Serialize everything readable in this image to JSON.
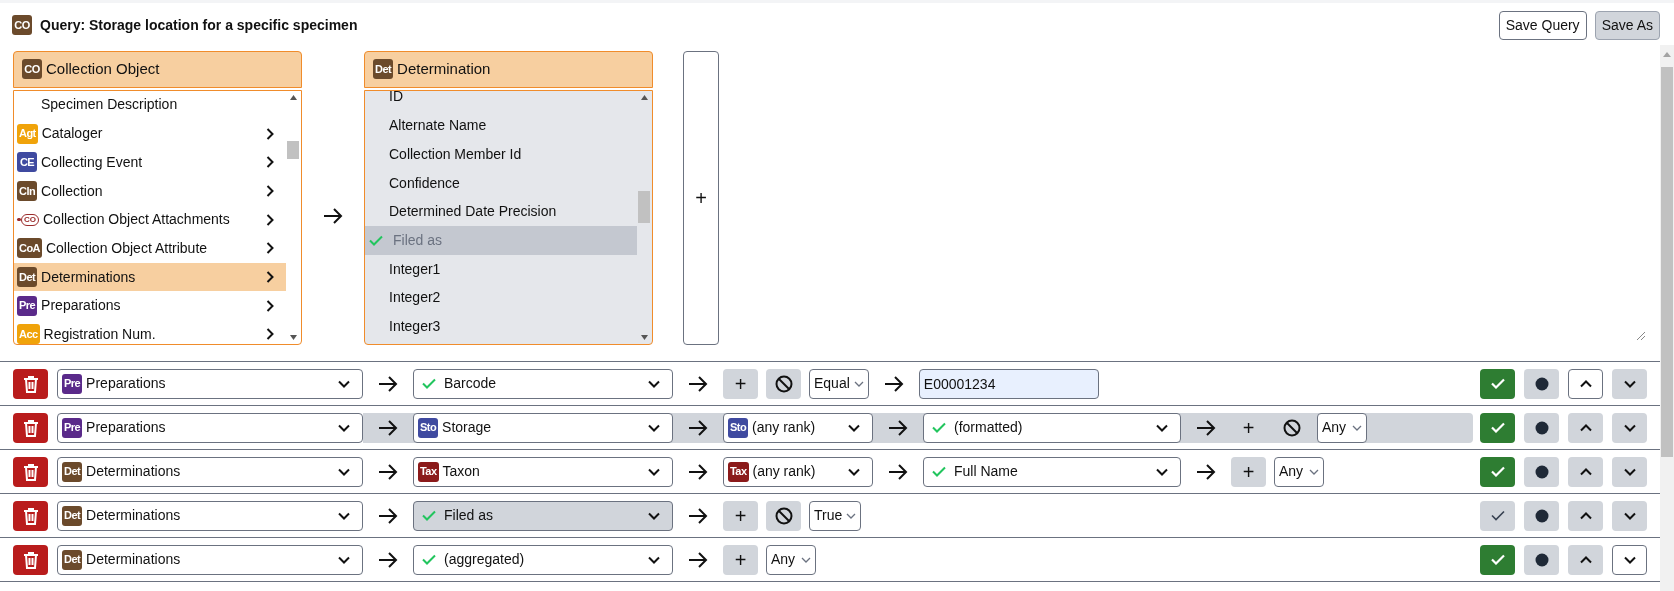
{
  "title": {
    "badge": {
      "text": "CO",
      "color": "#6b4a2b"
    },
    "text": "Query: Storage location for a specific specimen"
  },
  "header_buttons": [
    {
      "label": "Save Query",
      "disabled": false
    },
    {
      "label": "Save As",
      "disabled": true
    }
  ],
  "base_table": {
    "badge": {
      "text": "CO",
      "color": "#6b4a2b"
    },
    "label": "Collection Object",
    "items": [
      {
        "label": "Specimen Description",
        "expandable": false,
        "selected": false
      },
      {
        "label": "Cataloger",
        "badge": {
          "kind": "badge",
          "text": "Agt",
          "color": "#f0a30a"
        },
        "expandable": true,
        "selected": false
      },
      {
        "label": "Collecting Event",
        "badge": {
          "kind": "badge",
          "text": "CE",
          "color": "#3f4aa0"
        },
        "expandable": true,
        "selected": false
      },
      {
        "label": "Collection",
        "badge": {
          "kind": "badge",
          "text": "Cln",
          "color": "#6b4a2b"
        },
        "expandable": true,
        "selected": false
      },
      {
        "label": "Collection Object Attachments",
        "badge": {
          "kind": "attachment",
          "text": "CO",
          "color": "#9b2c2c"
        },
        "expandable": true,
        "selected": false
      },
      {
        "label": "Collection Object Attribute",
        "badge": {
          "kind": "badge",
          "text": "CoA",
          "color": "#6b4a2b"
        },
        "expandable": true,
        "selected": false
      },
      {
        "label": "Determinations",
        "badge": {
          "kind": "badge",
          "text": "Det",
          "color": "#6b4a2b"
        },
        "expandable": true,
        "selected": true
      },
      {
        "label": "Preparations",
        "badge": {
          "kind": "badge",
          "text": "Pre",
          "color": "#5a2a8a"
        },
        "expandable": true,
        "selected": false
      },
      {
        "label": "Registration Num.",
        "badge": {
          "kind": "badge",
          "text": "Acc",
          "color": "#f0a30a"
        },
        "expandable": true,
        "selected": false
      }
    ]
  },
  "related_table": {
    "badge": {
      "text": "Det",
      "color": "#6b4a2b"
    },
    "label": "Determination",
    "items": [
      {
        "label": "ID",
        "selected": false
      },
      {
        "label": "Alternate Name",
        "selected": false
      },
      {
        "label": "Collection Member Id",
        "selected": false
      },
      {
        "label": "Confidence",
        "selected": false
      },
      {
        "label": "Determined Date Precision",
        "selected": false
      },
      {
        "label": "Filed as",
        "selected": true
      },
      {
        "label": "Integer1",
        "selected": false
      },
      {
        "label": "Integer2",
        "selected": false
      },
      {
        "label": "Integer3",
        "selected": false
      }
    ]
  },
  "add_panel": {
    "label": "+"
  },
  "fields": [
    {
      "highlighted": false,
      "display": true,
      "up_disabled": true,
      "down_disabled": false,
      "parts": [
        {
          "kind": "select",
          "label": "Preparations",
          "badge": {
            "text": "Pre",
            "color": "#5a2a8a"
          },
          "checked": false,
          "active": false
        },
        {
          "kind": "select",
          "label": "Barcode",
          "checked": true,
          "active": false
        },
        {
          "kind": "plus",
          "label": "+"
        },
        {
          "kind": "negate"
        },
        {
          "kind": "operator",
          "value": "Equal"
        },
        {
          "kind": "value",
          "value": "E00001234"
        }
      ]
    },
    {
      "highlighted": true,
      "display": true,
      "up_disabled": false,
      "down_disabled": false,
      "parts": [
        {
          "kind": "select",
          "label": "Preparations",
          "badge": {
            "text": "Pre",
            "color": "#5a2a8a"
          },
          "checked": false,
          "active": false
        },
        {
          "kind": "select",
          "label": "Storage",
          "badge": {
            "text": "Sto",
            "color": "#3f4aa0"
          },
          "checked": false,
          "active": false
        },
        {
          "kind": "select",
          "label": "(any rank)",
          "badge": {
            "text": "Sto",
            "color": "#3f4aa0"
          },
          "checked": false,
          "active": false
        },
        {
          "kind": "select",
          "label": "(formatted)",
          "checked": true,
          "active": false
        },
        {
          "kind": "plus",
          "label": "+"
        },
        {
          "kind": "negate"
        },
        {
          "kind": "operator",
          "value": "Any"
        }
      ]
    },
    {
      "highlighted": false,
      "display": true,
      "up_disabled": false,
      "down_disabled": false,
      "parts": [
        {
          "kind": "select",
          "label": "Determinations",
          "badge": {
            "text": "Det",
            "color": "#6b4a2b"
          },
          "checked": false,
          "active": false
        },
        {
          "kind": "select",
          "label": "Taxon",
          "badge": {
            "text": "Tax",
            "color": "#8b1a1a"
          },
          "checked": false,
          "active": false
        },
        {
          "kind": "select",
          "label": "(any rank)",
          "badge": {
            "text": "Tax",
            "color": "#8b1a1a"
          },
          "checked": false,
          "active": false
        },
        {
          "kind": "select",
          "label": "Full Name",
          "checked": true,
          "active": false
        },
        {
          "kind": "plus",
          "label": "+"
        },
        {
          "kind": "operator",
          "value": "Any"
        }
      ]
    },
    {
      "highlighted": false,
      "display": false,
      "up_disabled": false,
      "down_disabled": false,
      "parts": [
        {
          "kind": "select",
          "label": "Determinations",
          "badge": {
            "text": "Det",
            "color": "#6b4a2b"
          },
          "checked": false,
          "active": false
        },
        {
          "kind": "select",
          "label": "Filed as",
          "checked": true,
          "active": true
        },
        {
          "kind": "plus",
          "label": "+"
        },
        {
          "kind": "negate"
        },
        {
          "kind": "operator",
          "value": "True"
        }
      ]
    },
    {
      "highlighted": false,
      "display": true,
      "up_disabled": false,
      "down_disabled": true,
      "parts": [
        {
          "kind": "select",
          "label": "Determinations",
          "badge": {
            "text": "Det",
            "color": "#6b4a2b"
          },
          "checked": false,
          "active": false
        },
        {
          "kind": "select",
          "label": "(aggregated)",
          "checked": true,
          "active": false
        },
        {
          "kind": "plus",
          "label": "+"
        },
        {
          "kind": "operator",
          "value": "Any"
        }
      ]
    }
  ]
}
